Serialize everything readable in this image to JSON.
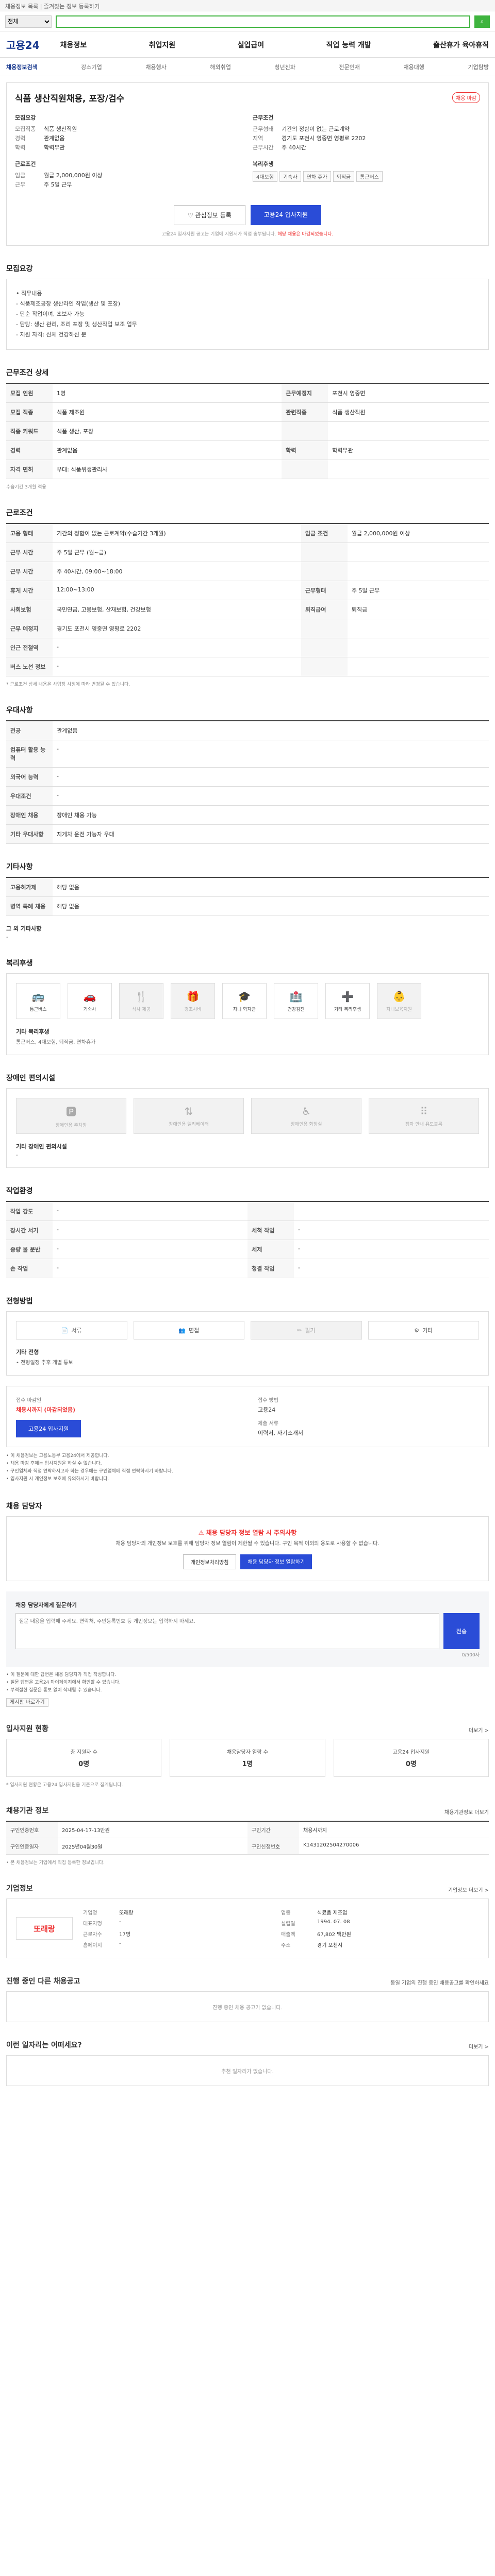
{
  "topbar": "채용정보 목록 | 즐겨찾는 정보 등록하기",
  "search": {
    "select": "전체",
    "placeholder": "",
    "button": "검색"
  },
  "logo": "고용24",
  "gnb": [
    "채용정보",
    "취업지원",
    "실업급여",
    "직업 능력 개발",
    "출산휴가 육아휴직"
  ],
  "subnav": [
    "채용정보검색",
    "강소기업",
    "채용행사",
    "해외취업",
    "청년친화",
    "전문인재",
    "채용대행",
    "기업탐방"
  ],
  "job": {
    "title": "식품 생산직원채용, 포장/검수",
    "badge": "채용 마감",
    "left": {
      "g1t": "모집요강",
      "g1": [
        [
          "모집직종",
          "식품 생산직원"
        ],
        [
          "경력",
          "관계없음"
        ],
        [
          "학력",
          "학력무관"
        ]
      ],
      "g2t": "근로조건",
      "g2": [
        [
          "임금",
          "월급 2,000,000원 이상"
        ],
        [
          "근무",
          "주 5일 근무"
        ]
      ]
    },
    "right": {
      "g1t": "근무조건",
      "g1": [
        [
          "근무형태",
          "기간의 정함이 없는 근로계약"
        ],
        [
          "지역",
          "경기도 포천시 영중면 영평로 2202"
        ],
        [
          "근무시간",
          "주 40시간"
        ]
      ],
      "g2t": "복리후생",
      "tags": [
        "4대보험",
        "기숙사",
        "연차 휴가",
        "퇴직금",
        "통근버스"
      ]
    },
    "btn_fav": "관심정보 등록",
    "btn_apply": "고용24 입사지원",
    "note_a": "고용24 입사지원 공고는 기업에 지원서가 직접 송부됩니다.",
    "note_red": "해당 채용은 마감되었습니다."
  },
  "s_recruit": {
    "title": "모집요강",
    "body": [
      "• 직무내용",
      "- 식품제조공장 생산라인 작업(생산 및 포장)",
      "- 단순 작업이며, 초보자 가능",
      "- 담당: 생산 관리, 조리 포장 및 생산작업 보조 업무",
      "- 지원 자격: 신체 건강하신 분"
    ]
  },
  "s_detail": {
    "title": "근무조건 상세",
    "rows": [
      [
        [
          "모집 인원",
          "1명"
        ],
        [
          "근무예정지",
          "포천시 영중면"
        ]
      ],
      [
        [
          "모집 직종",
          "식품 제조원"
        ],
        [
          "관련직종",
          "식품 생산직원"
        ]
      ],
      [
        [
          "직종 키워드",
          "식품 생산, 포장"
        ],
        [
          "",
          ""
        ]
      ],
      [
        [
          "경력",
          "관계없음"
        ],
        [
          "학력",
          "학력무관"
        ]
      ],
      [
        [
          "자격 면허",
          "우대: 식품위생관리사"
        ],
        [
          "",
          ""
        ]
      ]
    ],
    "note": "수습기간 3개월 적용"
  },
  "s_work": {
    "title": "근로조건",
    "rows": [
      [
        [
          "고용 형태",
          "기간의 정함이 없는 근로계약(수습기간 3개월)"
        ],
        [
          "임금 조건",
          "월급 2,000,000원 이상"
        ]
      ],
      [
        [
          "근무 시간",
          "주 5일 근무 (월~금)"
        ],
        [
          "",
          ""
        ]
      ],
      [
        [
          "근무 시간",
          "주 40시간, 09:00~18:00"
        ],
        [
          "",
          ""
        ]
      ],
      [
        [
          "휴게 시간",
          "12:00~13:00"
        ],
        [
          "근무형태",
          "주 5일 근무"
        ]
      ],
      [
        [
          "사회보험",
          "국민연금, 고용보험, 산재보험, 건강보험"
        ],
        [
          "퇴직급여",
          "퇴직금"
        ]
      ],
      [
        [
          "근무 예정지",
          "경기도 포천시 영중면 영평로 2202"
        ],
        [
          "",
          ""
        ]
      ],
      [
        [
          "인근 전철역",
          "-"
        ],
        [
          "",
          ""
        ]
      ],
      [
        [
          "버스 노선 정보",
          "-"
        ],
        [
          "",
          ""
        ]
      ]
    ],
    "note": "* 근로조건 상세 내용은 사업장 사정에 따라 변경될 수 있습니다."
  },
  "s_treat": {
    "title": "우대사항",
    "rows": [
      [
        "전공",
        "관계없음"
      ],
      [
        "컴퓨터 활용 능력",
        "-"
      ],
      [
        "외국어 능력",
        "-"
      ],
      [
        "우대조건",
        "-"
      ],
      [
        "장애인 채용",
        "장애인 채용 가능"
      ],
      [
        "기타 우대사항",
        "지게차 운전 가능자 우대"
      ]
    ]
  },
  "s_other": {
    "title": "기타사항",
    "rows": [
      [
        "고용허가제",
        "해당 없음"
      ],
      [
        "병역 특례 채용",
        "해당 없음"
      ]
    ],
    "sub": "그 외 기타사항",
    "subv": "-"
  },
  "s_welfare": {
    "title": "복리후생",
    "items": [
      [
        "통근버스",
        "🚌",
        false
      ],
      [
        "기숙사",
        "🚗",
        false
      ],
      [
        "식사 제공",
        "🍴",
        true
      ],
      [
        "경조사비",
        "🎁",
        true
      ],
      [
        "자녀 학자금",
        "🎓",
        false
      ],
      [
        "건강검진",
        "🏥",
        false
      ],
      [
        "기타 복리후생",
        "➕",
        false
      ],
      [
        "자녀보육지원",
        "👶",
        true
      ]
    ],
    "sub": "기타 복리후생",
    "subv": "통근버스, 4대보험, 퇴직금, 연차휴가"
  },
  "s_facility": {
    "title": "장애인 편의시설",
    "items": [
      [
        "장애인용 주차장",
        "🅿"
      ],
      [
        "장애인용 엘리베이터",
        "⇅"
      ],
      [
        "장애인용 화장실",
        "♿"
      ],
      [
        "점자 안내 유도블록",
        "⠿"
      ]
    ],
    "sub": "기타 장애인 편의시설",
    "subv": "-"
  },
  "s_env": {
    "title": "작업환경",
    "rows": [
      [
        [
          "작업 강도",
          "-"
        ],
        [
          "",
          ""
        ]
      ],
      [
        [
          "장시간 서기",
          "-"
        ],
        [
          "세척 작업",
          "-"
        ]
      ],
      [
        [
          "중량 물 운반",
          "-"
        ],
        [
          "세제",
          "-"
        ]
      ],
      [
        [
          "손 작업",
          "-"
        ],
        [
          "청결 작업",
          "-"
        ]
      ]
    ]
  },
  "s_process": {
    "title": "전형방법",
    "items": [
      [
        "서류",
        "📄",
        false
      ],
      [
        "면접",
        "👥",
        false
      ],
      [
        "필기",
        "✏",
        true
      ],
      [
        "기타",
        "⚙",
        false
      ]
    ],
    "sub": "기타 전형",
    "subv": "• 전형일정 추후 개별 통보"
  },
  "s_apply": {
    "l1": "접수 마감일",
    "l1v": "채용시까지 (마감되었음)",
    "l2": "접수 방법",
    "l2v": "고용24",
    "l3": "제출 서류",
    "l3v": "이력서, 자기소개서",
    "btn": "고용24 입사지원",
    "bullets": [
      "• 이 채용정보는 고용노동부 고용24에서 제공합니다.",
      "• 채용 마감 후에는 입사지원을 하실 수 없습니다.",
      "• 구인업체와 직접 연락하시고자 하는 경우에는 구인업체에 직접 연락하시기 바랍니다.",
      "• 입사지원 시 개인정보 보호에 유의하시기 바랍니다."
    ]
  },
  "s_contact": {
    "title": "채용 담당자",
    "wt": "채용 담당자 정보 열람 시 주의사항",
    "wd": "채용 담당자의 개인정보 보호를 위해 담당자 정보 열람이 제한될 수 있습니다.\n구인 목적 이외의 용도로 사용할 수 없습니다.",
    "b1": "개인정보처리방침",
    "b2": "채용 담당자 정보 열람하기"
  },
  "s_qna": {
    "h": "채용 담당자에게 질문하기",
    "ph": "질문 내용을 입력해 주세요. 연락처, 주민등록번호 등 개인정보는 입력하지 마세요.",
    "btn": "전송",
    "count": "0/500자",
    "bullets": [
      "• 이 질문에 대한 답변은 채용 담당자가 직접 작성합니다.",
      "• 질문 답변은 고용24 마이페이지에서 확인할 수 있습니다.",
      "• 부적절한 질문은 통보 없이 삭제될 수 있습니다."
    ],
    "btn2": "게시판 바로가기"
  },
  "s_stats": {
    "title": "입사지원 현황",
    "more": "더보기 >",
    "items": [
      [
        "총 지원자 수",
        "0명"
      ],
      [
        "채용담당자 열람 수",
        "1명"
      ],
      [
        "고용24 입사지원",
        "0명"
      ]
    ],
    "note": "* 입사지원 현황은 고용24 입사지원을 기준으로 집계됩니다."
  },
  "s_info": {
    "title": "채용기관 정보",
    "more": "채용기관정보 더보기",
    "rows": [
      [
        [
          "구인인증번호",
          "2025-04-17-13만원"
        ],
        [
          "구인기간",
          "채용시까지"
        ]
      ],
      [
        [
          "구인인증일자",
          "2025년04월30일"
        ],
        [
          "구인신청번호",
          "K1431202504270006"
        ]
      ]
    ],
    "note": "• 본 채용정보는 기업에서 직접 등록한 정보입니다."
  },
  "s_company": {
    "title": "기업정보",
    "more": "기업정보 더보기 >",
    "logo": "또래랑",
    "rows": [
      [
        "기업명",
        "또래랑"
      ],
      [
        "업종",
        "식료품 제조업"
      ],
      [
        "대표자명",
        "-"
      ],
      [
        "설립일",
        "1994. 07. 08"
      ],
      [
        "근로자수",
        "17명"
      ],
      [
        "매출액",
        "67,802 백만원"
      ],
      [
        "홈페이지",
        "-"
      ],
      [
        "주소",
        "경기 포천시"
      ]
    ]
  },
  "s_same": {
    "title": "진행 중인 다른 채용공고",
    "more": "동일 기업의 진행 중인 채용공고를 확인하세요",
    "empty": "진행 중인 채용 공고가 없습니다."
  },
  "s_recommend": {
    "title": "이런 일자리는 어떠세요?",
    "more": "더보기 >",
    "empty": "추천 일자리가 없습니다."
  }
}
